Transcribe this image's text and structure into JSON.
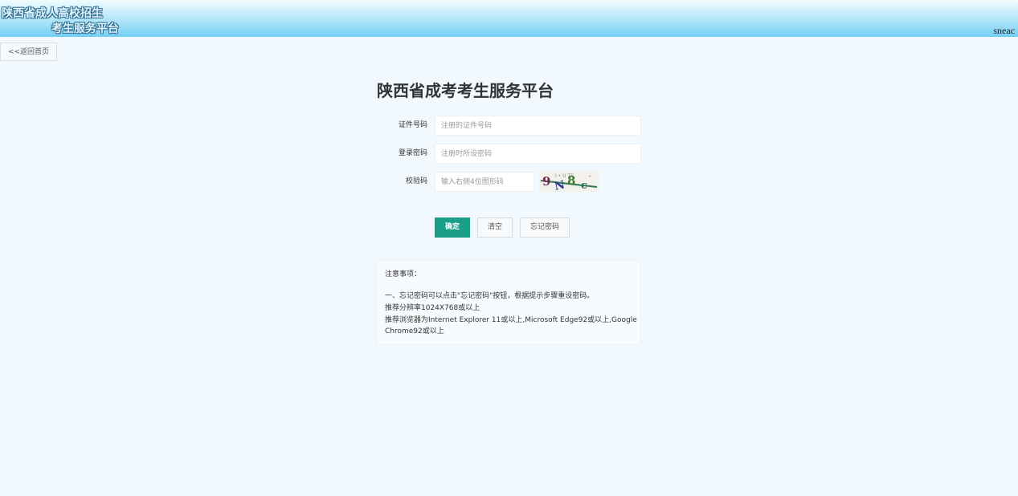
{
  "header": {
    "logo_line1": "陕西省成人高校招生",
    "logo_line2": "考生服务平台",
    "brand": "sneac",
    "gradient_colors": [
      "#f0fbff",
      "#bde9fb",
      "#73cff4"
    ]
  },
  "nav": {
    "back_label": "<<返回首页"
  },
  "page_title": "陕西省成考考生服务平台",
  "form": {
    "id_label": "证件号码",
    "id_placeholder": "注册的证件号码",
    "id_value": "",
    "password_label": "登录密码",
    "password_placeholder": "注册时所设密码",
    "password_value": "",
    "captcha_label": "校验码",
    "captcha_placeholder": "输入右侧4位图形码",
    "captcha_value": "",
    "captcha_text": "9N8c"
  },
  "buttons": {
    "confirm": "确定",
    "clear": "清空",
    "forgot": "忘记密码"
  },
  "notice": {
    "title": "注意事项：",
    "line1": "一、忘记密码可以点击\"忘记密码\"按钮，根据提示步骤重设密码。",
    "line2": "推荐分辨率1024X768或以上",
    "line3": "推荐浏览器为Internet Explorer 11或以上,Microsoft Edge92或以上,Google Chrome92或以上"
  },
  "colors": {
    "accent": "#1a9e88",
    "background": "#f1f8fe"
  }
}
